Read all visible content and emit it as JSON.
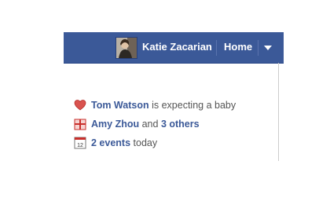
{
  "header": {
    "user_name": "Katie Zacarian",
    "home_label": "Home",
    "menu_icon": "chevron-down-icon"
  },
  "notifications": [
    {
      "icon": "heart-icon",
      "name": "Tom Watson",
      "text": "is expecting a baby"
    },
    {
      "icon": "gift-icon",
      "name": "Amy Zhou",
      "connector": "and",
      "others": "3 others"
    },
    {
      "icon": "calendar-icon",
      "calendar_day": "12",
      "events": "2 events",
      "when": "today"
    }
  ],
  "colors": {
    "brand": "#3b5998",
    "link": "#3b5998",
    "heart": "#d9534f",
    "gift": "#c9302c"
  }
}
